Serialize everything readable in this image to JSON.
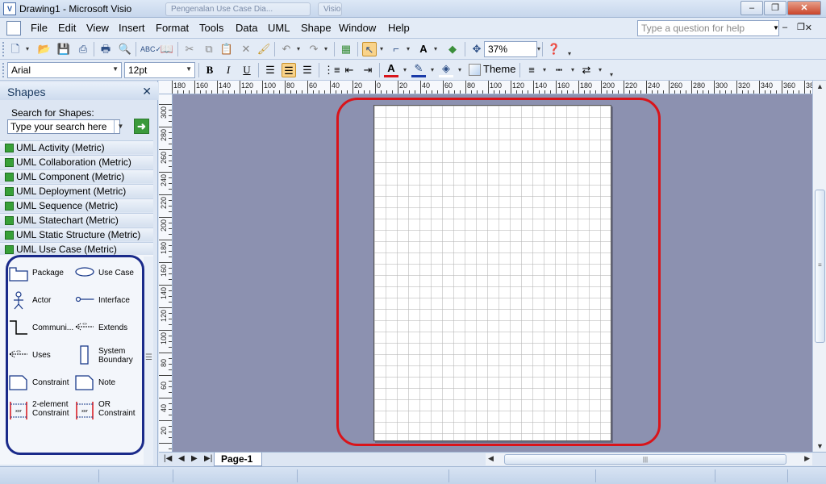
{
  "window": {
    "title": "Drawing1 - Microsoft Visio",
    "ghost_tabs": [
      "Pengenalan Use Case Dia...",
      "Visio"
    ]
  },
  "menu": {
    "items": [
      "File",
      "Edit",
      "View",
      "Insert",
      "Format",
      "Tools",
      "Data",
      "UML",
      "Shape",
      "Window",
      "Help"
    ],
    "help_placeholder": "Type a question for help"
  },
  "toolbar": {
    "zoom": "37%",
    "font": "Arial",
    "font_size": "12pt",
    "theme_label": "Theme",
    "bold": "B",
    "italic": "I",
    "underline": "U",
    "font_color": "A"
  },
  "shapes": {
    "header": "Shapes",
    "search_label": "Search for Shapes:",
    "search_placeholder": "Type your search here",
    "stencils": [
      "UML Activity (Metric)",
      "UML Collaboration (Metric)",
      "UML Component (Metric)",
      "UML Deployment (Metric)",
      "UML Sequence (Metric)",
      "UML Statechart (Metric)",
      "UML Static Structure (Metric)",
      "UML Use Case (Metric)"
    ],
    "masters": {
      "package": "Package",
      "use_case": "Use Case",
      "actor": "Actor",
      "interface": "Interface",
      "communication": "Communi...",
      "extends": "Extends",
      "uses": "Uses",
      "system_boundary": "System Boundary",
      "constraint": "Constraint",
      "note": "Note",
      "two_element_constraint": "2-element Constraint",
      "or_constraint": "OR Constraint"
    }
  },
  "rulers": {
    "horizontal": [
      "180",
      "160",
      "140",
      "120",
      "100",
      "80",
      "60",
      "40",
      "20",
      "0",
      "20",
      "40",
      "60",
      "80",
      "100",
      "120",
      "140",
      "160",
      "180",
      "200",
      "220",
      "240",
      "260",
      "280",
      "300",
      "320",
      "340",
      "360",
      "380"
    ],
    "vertical": [
      "300",
      "280",
      "260",
      "240",
      "220",
      "200",
      "180",
      "160",
      "140",
      "120",
      "100",
      "80",
      "60",
      "40",
      "20",
      "0"
    ]
  },
  "page_tabs": {
    "current": "Page-1"
  },
  "colors": {
    "canvas_bg": "#8c91b0",
    "page_highlight": "#d9141a",
    "shapes_highlight": "#1a2a8a",
    "stencil_icon": "#38a038"
  }
}
